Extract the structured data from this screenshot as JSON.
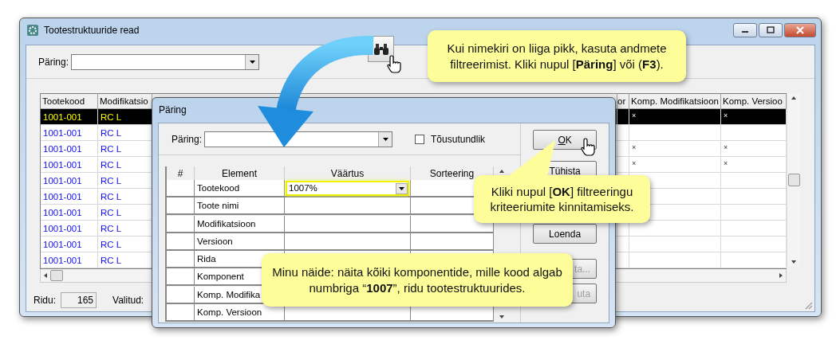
{
  "main_window": {
    "title": "Tootestruktuuride read",
    "query_label": "Päring:",
    "columns": [
      {
        "label": "Tootekood"
      },
      {
        "label": "Modifikatsio"
      },
      {
        "label": "or"
      },
      {
        "label": "Komp. Modifikatsioon"
      },
      {
        "label": "Komp. Versioo"
      }
    ],
    "rows": [
      {
        "cells": [
          "1001-001",
          "RC L",
          "",
          "×",
          "×"
        ],
        "selected": true
      },
      {
        "cells": [
          "1001-001",
          "RC L",
          "",
          "",
          ""
        ],
        "selected": false
      },
      {
        "cells": [
          "1001-001",
          "RC L",
          "",
          "×",
          "×"
        ],
        "selected": false
      },
      {
        "cells": [
          "1001-001",
          "RC L",
          "",
          "×",
          "×"
        ],
        "selected": false
      },
      {
        "cells": [
          "1001-001",
          "RC L",
          "",
          "",
          ""
        ],
        "selected": false
      },
      {
        "cells": [
          "1001-001",
          "RC L",
          "",
          "",
          ""
        ],
        "selected": false
      },
      {
        "cells": [
          "1001-001",
          "RC L",
          "",
          "",
          ""
        ],
        "selected": false
      },
      {
        "cells": [
          "1001-001",
          "RC L",
          "",
          "",
          ""
        ],
        "selected": false
      },
      {
        "cells": [
          "1001-001",
          "RC L",
          "",
          "",
          ""
        ],
        "selected": false
      },
      {
        "cells": [
          "1001-001",
          "RC L",
          "",
          "",
          ""
        ],
        "selected": false
      }
    ],
    "status": {
      "rows_label": "Ridu:",
      "rows_value": "165",
      "selected_label": "Valitud:"
    }
  },
  "dialog": {
    "title": "Päring",
    "query_label": "Päring:",
    "case_sensitive": {
      "label": "Tõusutundlik",
      "checked": false
    },
    "columns": [
      "#",
      "Element",
      "Väärtus",
      "Sorteering"
    ],
    "rows": [
      {
        "element": "Tootekood",
        "value": "1007%",
        "highlighted": true
      },
      {
        "element": "Toote nimi",
        "value": "",
        "highlighted": false
      },
      {
        "element": "Modifikatsioon",
        "value": "",
        "highlighted": false
      },
      {
        "element": "Versioon",
        "value": "",
        "highlighted": false
      },
      {
        "element": "Rida",
        "value": "",
        "highlighted": false
      },
      {
        "element": "Komponent",
        "value": "",
        "highlighted": false
      },
      {
        "element": "Komp. Modifika",
        "value": "",
        "highlighted": false
      },
      {
        "element": "Komp. Versioon",
        "value": "",
        "highlighted": false
      }
    ],
    "buttons": [
      {
        "label": "OK",
        "disabled": false,
        "mnemonic": true
      },
      {
        "label": "Tühista",
        "disabled": false,
        "mnemonic": false
      },
      {
        "label": "Loenda",
        "disabled": false,
        "mnemonic": false
      },
      {
        "label": "ta...",
        "disabled": true,
        "mnemonic": false
      },
      {
        "label": "uta",
        "disabled": true,
        "mnemonic": false
      }
    ]
  },
  "callouts": [
    {
      "text": "Kui nimekiri on liiga pikk, kasuta andmete filtreerimist. Kliki nupul [**Päring**] või (**F3**)."
    },
    {
      "text": "Kliki nupul [**OK**] filtreeringu kriteeriumite kinnitamiseks."
    },
    {
      "text": "Minu näide: näita kõiki komponentide, mille kood algab numbriga “**1007**”, ridu tootestruktuurides."
    }
  ]
}
